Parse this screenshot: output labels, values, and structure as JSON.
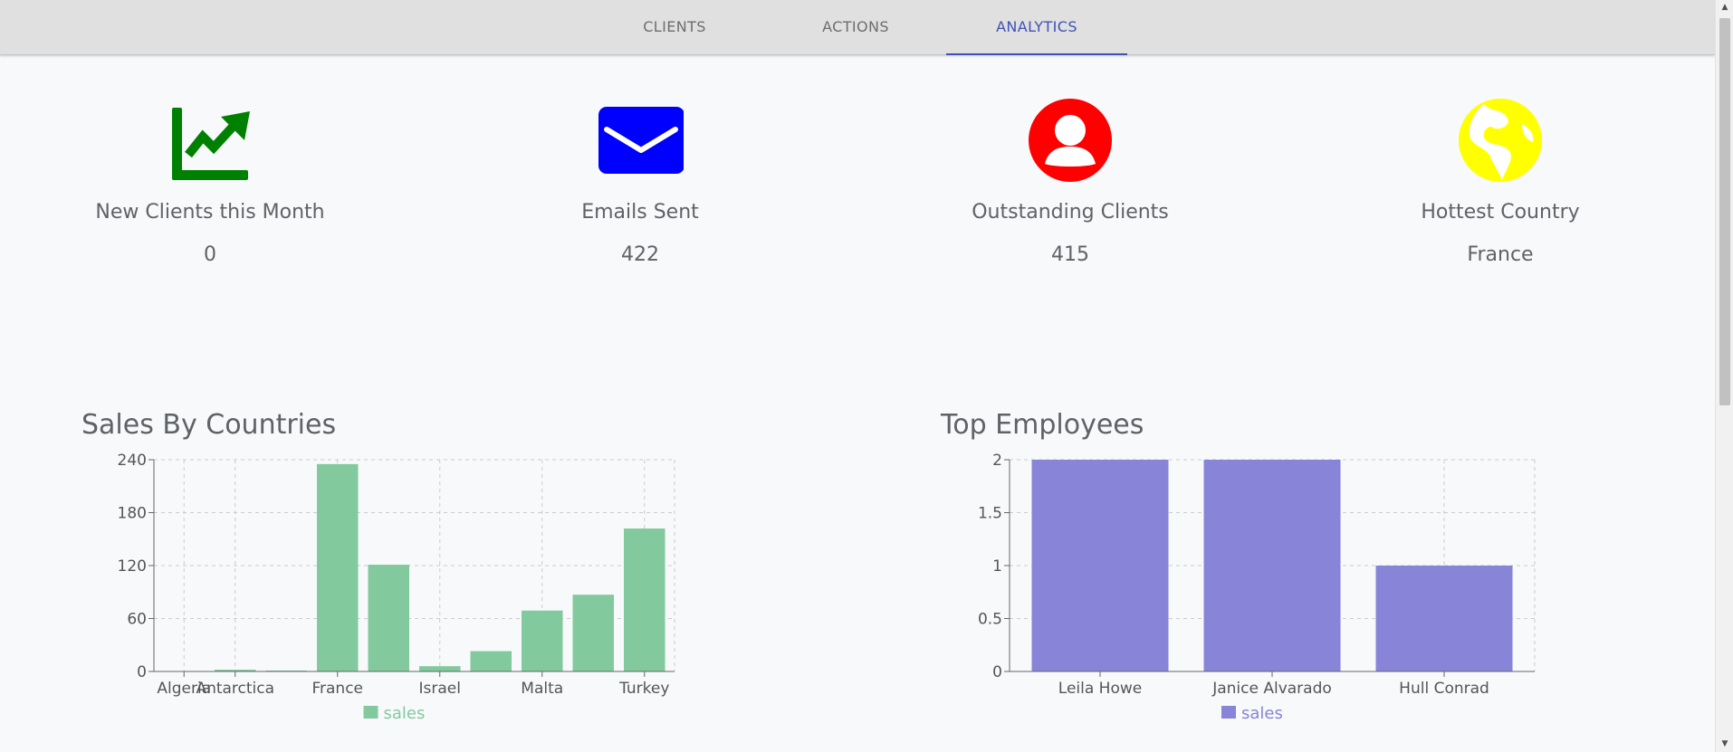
{
  "nav": {
    "tabs": [
      {
        "label": "CLIENTS",
        "active": false
      },
      {
        "label": "ACTIONS",
        "active": false
      },
      {
        "label": "ANALYTICS",
        "active": true
      }
    ],
    "accent_color": "#3f51b5"
  },
  "stats": [
    {
      "icon": "trending-up-icon",
      "color": "#008000",
      "label": "New Clients this Month",
      "value": "0"
    },
    {
      "icon": "envelope-icon",
      "color": "#0000ff",
      "label": "Emails Sent",
      "value": "422"
    },
    {
      "icon": "user-circle-icon",
      "color": "#ff0000",
      "label": "Outstanding Clients",
      "value": "415"
    },
    {
      "icon": "globe-icon",
      "color": "#ffff00",
      "label": "Hottest Country",
      "value": "France"
    }
  ],
  "chart_data": [
    {
      "type": "bar",
      "title": "Sales By Countries",
      "categories": [
        "Algeria",
        "Antarctica",
        "",
        "France",
        "",
        "Israel",
        "",
        "Malta",
        "",
        "Turkey"
      ],
      "series": [
        {
          "name": "sales",
          "color": "#82ca9d",
          "values": [
            0,
            2,
            1,
            235,
            121,
            6,
            23,
            69,
            87,
            162
          ]
        }
      ],
      "ylim": [
        0,
        240
      ],
      "yticks": [
        "0",
        "60",
        "120",
        "180",
        "240"
      ],
      "grid": true,
      "legend": "bottom-center"
    },
    {
      "type": "bar",
      "title": "Top Employees",
      "categories": [
        "Leila Howe",
        "Janice Alvarado",
        "Hull Conrad"
      ],
      "series": [
        {
          "name": "sales",
          "color": "#8884d8",
          "values": [
            2,
            2,
            1
          ]
        }
      ],
      "ylim": [
        0,
        2
      ],
      "yticks": [
        "0",
        "0.5",
        "1",
        "1.5",
        "2"
      ],
      "grid": true,
      "legend": "bottom-center"
    }
  ]
}
